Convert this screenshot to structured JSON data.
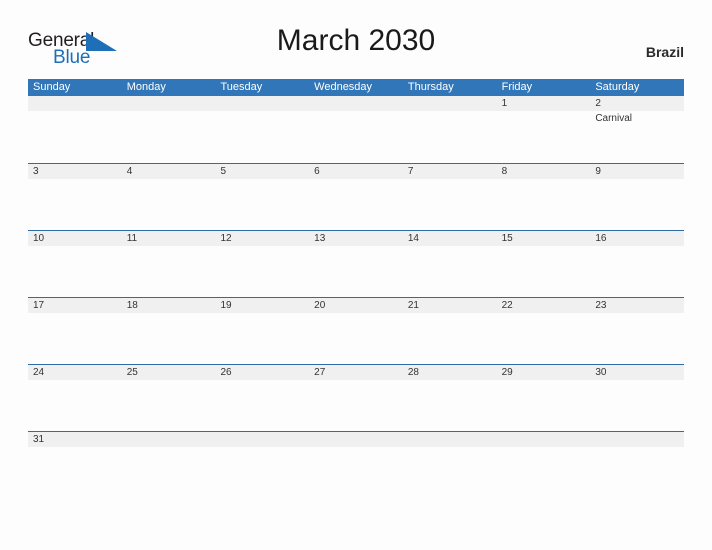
{
  "brand": {
    "name_top": "General",
    "name_bottom": "Blue",
    "flag_icon": "blue-triangle-flag-icon",
    "color_top": "#231f20",
    "color_bottom": "#1f6fb8"
  },
  "header": {
    "title": "March 2030",
    "country": "Brazil"
  },
  "calendar": {
    "accent_color": "#3176b8",
    "row_line_color": "#2e6da4",
    "band_color": "#f0f0f0",
    "weekdays": [
      "Sunday",
      "Monday",
      "Tuesday",
      "Wednesday",
      "Thursday",
      "Friday",
      "Saturday"
    ],
    "weeks": [
      {
        "days": [
          {
            "num": "",
            "events": []
          },
          {
            "num": "",
            "events": []
          },
          {
            "num": "",
            "events": []
          },
          {
            "num": "",
            "events": []
          },
          {
            "num": "",
            "events": []
          },
          {
            "num": "1",
            "events": []
          },
          {
            "num": "2",
            "events": [
              "Carnival"
            ]
          }
        ]
      },
      {
        "days": [
          {
            "num": "3",
            "events": []
          },
          {
            "num": "4",
            "events": []
          },
          {
            "num": "5",
            "events": []
          },
          {
            "num": "6",
            "events": []
          },
          {
            "num": "7",
            "events": []
          },
          {
            "num": "8",
            "events": []
          },
          {
            "num": "9",
            "events": []
          }
        ]
      },
      {
        "days": [
          {
            "num": "10",
            "events": []
          },
          {
            "num": "11",
            "events": []
          },
          {
            "num": "12",
            "events": []
          },
          {
            "num": "13",
            "events": []
          },
          {
            "num": "14",
            "events": []
          },
          {
            "num": "15",
            "events": []
          },
          {
            "num": "16",
            "events": []
          }
        ]
      },
      {
        "days": [
          {
            "num": "17",
            "events": []
          },
          {
            "num": "18",
            "events": []
          },
          {
            "num": "19",
            "events": []
          },
          {
            "num": "20",
            "events": []
          },
          {
            "num": "21",
            "events": []
          },
          {
            "num": "22",
            "events": []
          },
          {
            "num": "23",
            "events": []
          }
        ]
      },
      {
        "days": [
          {
            "num": "24",
            "events": []
          },
          {
            "num": "25",
            "events": []
          },
          {
            "num": "26",
            "events": []
          },
          {
            "num": "27",
            "events": []
          },
          {
            "num": "28",
            "events": []
          },
          {
            "num": "29",
            "events": []
          },
          {
            "num": "30",
            "events": []
          }
        ]
      },
      {
        "days": [
          {
            "num": "31",
            "events": []
          },
          {
            "num": "",
            "events": []
          },
          {
            "num": "",
            "events": []
          },
          {
            "num": "",
            "events": []
          },
          {
            "num": "",
            "events": []
          },
          {
            "num": "",
            "events": []
          },
          {
            "num": "",
            "events": []
          }
        ]
      }
    ]
  }
}
